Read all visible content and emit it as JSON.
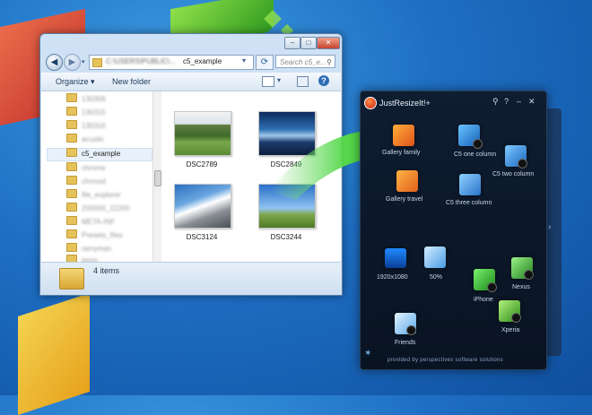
{
  "explorer": {
    "address_blurred": "C:\\USERS\\PUBLIC\\...",
    "address_current": "c5_example",
    "search_placeholder": "Search c5_e...",
    "toolbar": {
      "organize_label": "Organize",
      "new_folder_label": "New folder"
    },
    "nav_items": [
      {
        "label": "c5_example",
        "blurred": false
      }
    ],
    "files": [
      {
        "name": "DSC2789"
      },
      {
        "name": "DSC2849"
      },
      {
        "name": "DSC3124"
      },
      {
        "name": "DSC3244"
      }
    ],
    "status_text": "4 items"
  },
  "justresizeit": {
    "title": "JustResizeIt!+",
    "title_buttons": [
      "search-icon",
      "help-icon",
      "minimize-icon",
      "close-icon"
    ],
    "tiles": [
      {
        "label": "Gallery family"
      },
      {
        "label": "C5 one column"
      },
      {
        "label": "C5 two column"
      },
      {
        "label": "Gallery travel"
      },
      {
        "label": "C5 three column"
      },
      {
        "label": "1920x1080"
      },
      {
        "label": "50%"
      },
      {
        "label": "iPhone"
      },
      {
        "label": "Nexus"
      },
      {
        "label": "Xperia"
      },
      {
        "label": "Friends"
      }
    ],
    "footer": "provided by perspectives software solutions"
  }
}
